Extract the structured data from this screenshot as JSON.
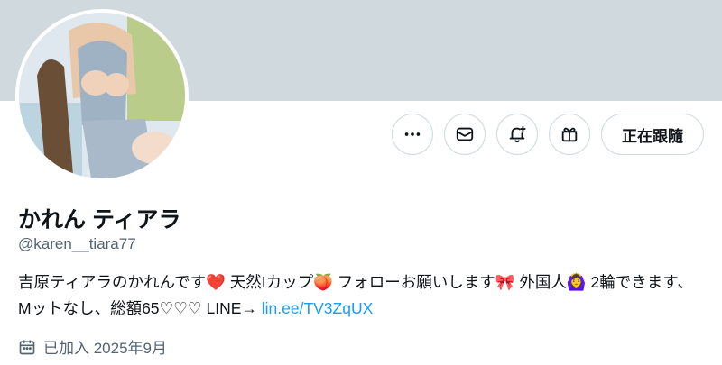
{
  "profile": {
    "display_name": "かれん ティアラ",
    "handle": "@karen__tiara77",
    "bio_text": "吉原ティアラのかれんです❤️ 天然Iカップ🍑 フォローお願いします🎀 外国人🙆‍♀️ 2輪できます、Mットなし、総額65♡♡♡ LINE→ ",
    "bio_link": "lin.ee/TV3ZqUX",
    "joined": "已加入 2025年9月"
  },
  "actions": {
    "more_icon": "more-horizontal-icon",
    "message_icon": "envelope-icon",
    "notify_icon": "bell-plus-icon",
    "gift_icon": "gift-icon",
    "following_label": "正在跟隨"
  },
  "colors": {
    "banner": "#cfd9de",
    "link": "#1d9bf0",
    "secondary_text": "#536471"
  }
}
